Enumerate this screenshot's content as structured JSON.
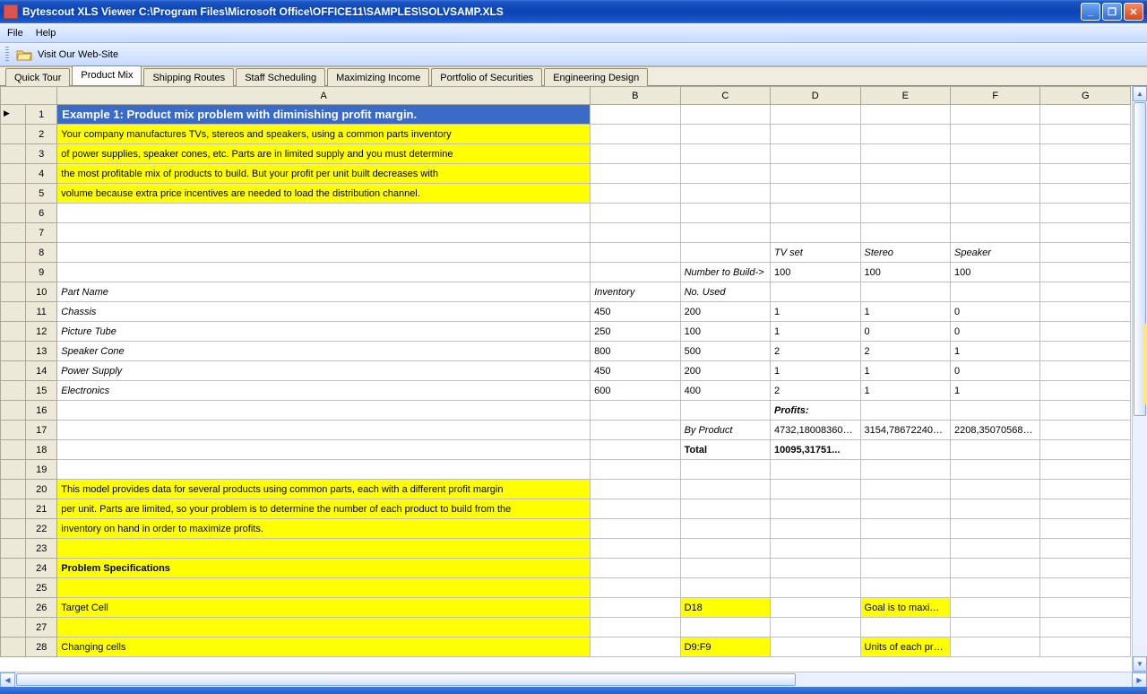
{
  "title": "Bytescout XLS Viewer C:\\Program Files\\Microsoft Office\\OFFICE11\\SAMPLES\\SOLVSAMP.XLS",
  "menu": {
    "file": "File",
    "help": "Help"
  },
  "toolbar": {
    "visit": "Visit Our Web-Site"
  },
  "tabs": [
    "Quick Tour",
    "Product Mix",
    "Shipping Routes",
    "Staff Scheduling",
    "Maximizing Income",
    "Portfolio of Securities",
    "Engineering Design"
  ],
  "active_tab": "Product Mix",
  "columns": [
    "",
    "A",
    "B",
    "C",
    "D",
    "E",
    "F",
    "G"
  ],
  "rows": {
    "r1": {
      "A": "Example 1:  Product mix problem with diminishing profit margin."
    },
    "r2": {
      "A": "Your company manufactures TVs, stereos and speakers, using a common parts inventory"
    },
    "r3": {
      "A": "of power supplies, speaker cones, etc.  Parts are in limited supply and you must determine"
    },
    "r4": {
      "A": "the most profitable mix of products to build. But your profit per unit built decreases with"
    },
    "r5": {
      "A": "volume because extra price incentives are needed to load the distribution channel."
    },
    "r8": {
      "D": "TV set",
      "E": "Stereo",
      "F": "Speaker"
    },
    "r9": {
      "C": "Number to Build->",
      "D": "100",
      "E": "100",
      "F": "100"
    },
    "r10": {
      "A": "Part Name",
      "B": "Inventory",
      "C": "No. Used"
    },
    "r11": {
      "A": "Chassis",
      "B": "450",
      "C": "200",
      "D": "1",
      "E": "1",
      "F": "0"
    },
    "r12": {
      "A": "Picture Tube",
      "B": "250",
      "C": "100",
      "D": "1",
      "E": "0",
      "F": "0"
    },
    "r13": {
      "A": "Speaker Cone",
      "B": "800",
      "C": "500",
      "D": "2",
      "E": "2",
      "F": "1"
    },
    "r14": {
      "A": "Power Supply",
      "B": "450",
      "C": "200",
      "D": "1",
      "E": "1",
      "F": "0"
    },
    "r15": {
      "A": "Electronics",
      "B": "600",
      "C": "400",
      "D": "2",
      "E": "1",
      "F": "1"
    },
    "r16": {
      "D": "Profits:"
    },
    "r17": {
      "C": "By Product",
      "D": "4732,180083601...",
      "E": "3154,786722400...",
      "F": "2208,350705680..."
    },
    "r18": {
      "C": "Total",
      "D": "10095,31751..."
    },
    "r20": {
      "A": "This model provides data for several products using common parts, each with a different profit margin"
    },
    "r21": {
      "A": "per unit.  Parts are limited, so your problem is to determine the number of each product to build from the"
    },
    "r22": {
      "A": "inventory on hand in order to maximize profits."
    },
    "r24": {
      "A": "Problem Specifications"
    },
    "r26": {
      "A": "Target Cell",
      "C": "D18",
      "E": "Goal is to maximiz..."
    },
    "r28": {
      "A": "Changing cells",
      "C": "D9:F9",
      "E": "Units of each pro..."
    }
  }
}
